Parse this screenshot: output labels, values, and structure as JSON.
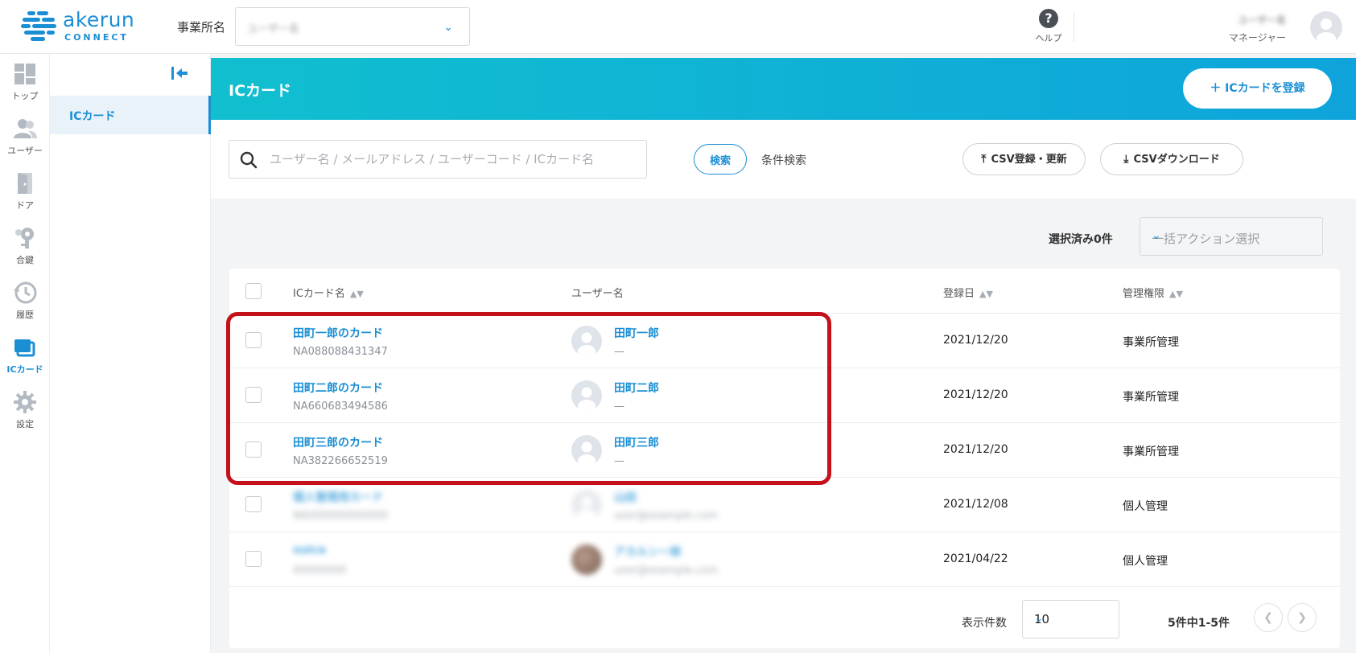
{
  "app": {
    "logo_word": "akerun",
    "logo_sub": "CONNECT"
  },
  "header": {
    "office_label": "事業所名",
    "office_value": "ユーザー名",
    "help_label": "ヘルプ",
    "user_name": "ユーザー名",
    "user_role": "マネージャー"
  },
  "left_nav": {
    "items": [
      {
        "label": "トップ",
        "icon": "dashboard-icon"
      },
      {
        "label": "ユーザー",
        "icon": "users-icon"
      },
      {
        "label": "ドア",
        "icon": "door-icon"
      },
      {
        "label": "合鍵",
        "icon": "key-icon"
      },
      {
        "label": "履歴",
        "icon": "history-icon"
      },
      {
        "label": "ICカード",
        "icon": "ic-card-icon"
      },
      {
        "label": "設定",
        "icon": "gear-icon"
      }
    ],
    "active_index": 5
  },
  "sub_nav": {
    "items": [
      {
        "label": "ICカード"
      }
    ]
  },
  "page": {
    "title": "ICカード",
    "register_label": "＋ ICカードを登録"
  },
  "search": {
    "placeholder": "ユーザー名 / メールアドレス / ユーザーコード / ICカード名",
    "value": "",
    "search_button": "検索",
    "advanced_label": "条件検索",
    "csv_upload": "CSV登録・更新",
    "csv_download": "CSVダウンロード"
  },
  "bulk": {
    "selected_count": "選択済み0件",
    "action_placeholder": "一括アクション選択"
  },
  "table": {
    "columns": [
      {
        "label": "ICカード名",
        "sortable": true
      },
      {
        "label": "ユーザー名",
        "sortable": false
      },
      {
        "label": "登録日",
        "sortable": true
      },
      {
        "label": "管理権限",
        "sortable": true
      }
    ],
    "rows": [
      {
        "card_name": "田町一郎のカード",
        "card_id": "NA088088431347",
        "user_name": "田町一郎",
        "user_sub": "—",
        "date": "2021/12/20",
        "permission": "事業所管理",
        "blurred": false
      },
      {
        "card_name": "田町二郎のカード",
        "card_id": "NA660683494586",
        "user_name": "田町二郎",
        "user_sub": "—",
        "date": "2021/12/20",
        "permission": "事業所管理",
        "blurred": false
      },
      {
        "card_name": "田町三郎のカード",
        "card_id": "NA382266652519",
        "user_name": "田町三郎",
        "user_sub": "—",
        "date": "2021/12/20",
        "permission": "事業所管理",
        "blurred": false
      },
      {
        "card_name": "個人管理用カード",
        "card_id": "NA000000000000",
        "user_name": "山田",
        "user_sub": "user@example.com",
        "date": "2021/12/08",
        "permission": "個人管理",
        "blurred": true
      },
      {
        "card_name": "suica",
        "card_id": "00000000",
        "user_name": "アカルン一郎",
        "user_sub": "user@example.com",
        "date": "2021/04/22",
        "permission": "個人管理",
        "blurred": true
      }
    ]
  },
  "pagination": {
    "per_page_label": "表示件数",
    "per_page_value": "10",
    "range_text": "5件中1-5件",
    "prev_icon": "chevron-left-icon",
    "next_icon": "chevron-right-icon"
  },
  "colors": {
    "accent": "#1b8fd4",
    "banner_start": "#11bfcf",
    "banner_end": "#0ea4db",
    "highlight": "#c5121a"
  }
}
